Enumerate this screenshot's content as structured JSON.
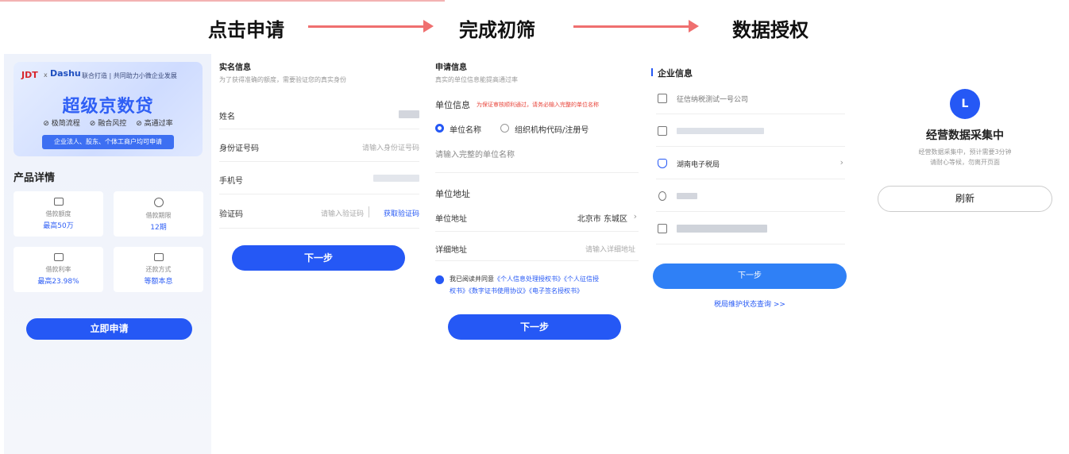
{
  "steps": {
    "step1": "点击申请",
    "step2": "完成初筛",
    "step3": "数据授权"
  },
  "panel1": {
    "logo_jdt": "JDT",
    "logo_x": "x",
    "logo_dashu": "Dashu",
    "slogan": "联合打造 | 共同助力小微企业发展",
    "title": "超级京数贷",
    "features": [
      "极简流程",
      "融合风控",
      "高通过率"
    ],
    "pill": "企业法人、股东、个体工商户均可申请",
    "product_title": "产品详情",
    "cards": [
      {
        "label": "借款额度",
        "value": "最高50万"
      },
      {
        "label": "借款期限",
        "value": "12期"
      },
      {
        "label": "借款利率",
        "value": "最高23.98%"
      },
      {
        "label": "还款方式",
        "value": "等额本息"
      }
    ],
    "apply_button": "立即申请"
  },
  "panel2": {
    "head": "实名信息",
    "sub": "为了获得准确的额度，需要验证您的真实身份",
    "name_label": "姓名",
    "id_label": "身份证号码",
    "id_placeholder": "请输入身份证号码",
    "phone_label": "手机号",
    "code_label": "验证码",
    "code_placeholder": "请输入验证码",
    "get_code": "获取验证码",
    "next": "下一步"
  },
  "panel3": {
    "head": "申请信息",
    "sub": "真实的单位信息能提高通过率",
    "unit_title": "单位信息",
    "unit_warn": "为保证审核顺利通过，请务必输入完整的单位名称",
    "opt1": "单位名称",
    "opt2": "组织机构代码/注册号",
    "unit_placeholder": "请输入完整的单位名称",
    "addr_title": "单位地址",
    "addr_label": "单位地址",
    "addr_value": "北京市 东城区",
    "detail_label": "详细地址",
    "detail_placeholder": "请输入详细地址",
    "agree_prefix": "我已阅读并同意",
    "agree_docs_1": "《个人信息处理授权书》《个人征信授",
    "agree_docs_2": "权书》《数字证书使用协议》《电子签名授权书》",
    "next": "下一步"
  },
  "panel4": {
    "head": "企业信息",
    "company": "征信纳税测试一号公司",
    "tax_bureau": "湖南电子税局",
    "next": "下一步",
    "status_link": "税局维护状态查询 >>"
  },
  "panel5": {
    "avatar_letter": "L",
    "title": "经营数据采集中",
    "desc1": "经营数据采集中，预计需要3分钟",
    "desc2": "请耐心等候，勿离开页面",
    "refresh": "刷新"
  },
  "colors": {
    "primary": "#2558f5",
    "arrow": "#ef6f6f",
    "warn": "#e8443a"
  }
}
